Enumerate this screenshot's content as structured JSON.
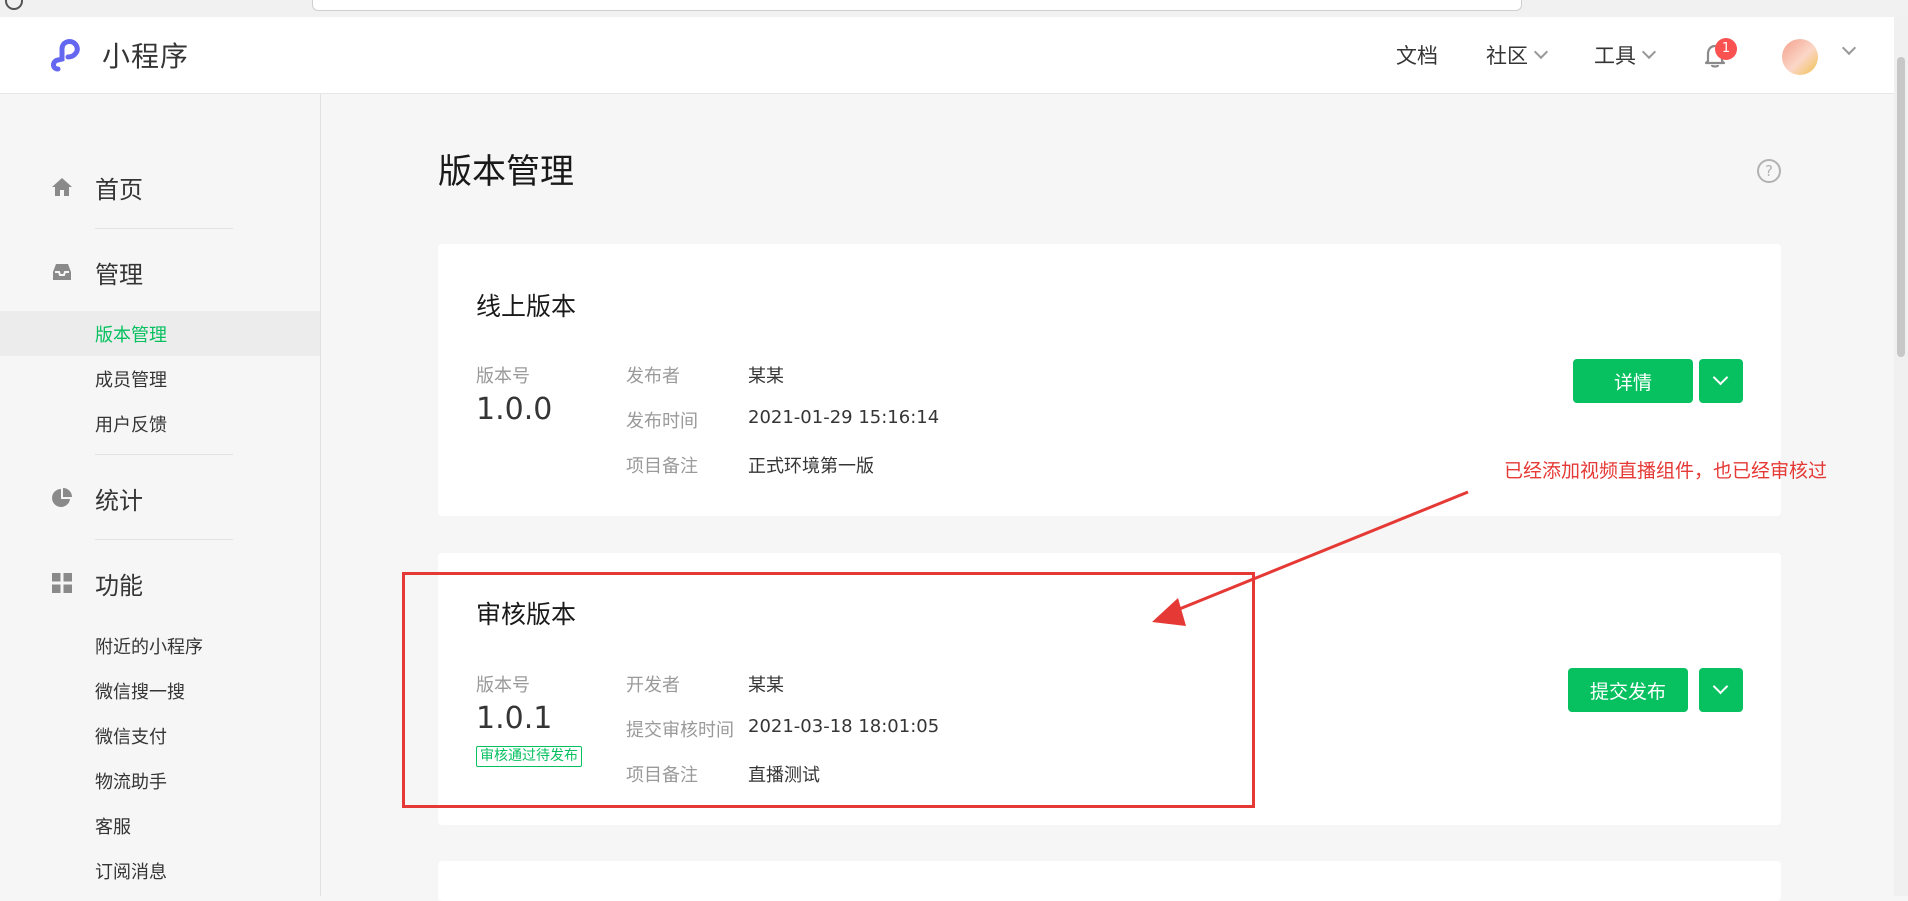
{
  "header": {
    "app_title": "小程序",
    "nav": {
      "docs": "文档",
      "community": "社区",
      "tools": "工具"
    },
    "notification_count": "1"
  },
  "sidebar": {
    "groups": [
      {
        "label": "首页",
        "icon": "home-icon"
      },
      {
        "label": "管理",
        "icon": "inbox-icon"
      },
      {
        "label": "统计",
        "icon": "pie-chart-icon"
      },
      {
        "label": "功能",
        "icon": "grid-icon"
      }
    ],
    "manage_items": [
      "版本管理",
      "成员管理",
      "用户反馈"
    ],
    "feature_items": [
      "附近的小程序",
      "微信搜一搜",
      "微信支付",
      "物流助手",
      "客服",
      "订阅消息"
    ],
    "active_item": "版本管理"
  },
  "main": {
    "title": "版本管理",
    "help": "?",
    "online": {
      "title": "线上版本",
      "version_label": "版本号",
      "version": "1.0.0",
      "publisher_label": "发布者",
      "publisher": "某某",
      "time_label": "发布时间",
      "time": "2021-01-29 15:16:14",
      "note_label": "项目备注",
      "note": "正式环境第一版",
      "button": "详情"
    },
    "review": {
      "title": "审核版本",
      "version_label": "版本号",
      "version": "1.0.1",
      "status": "审核通过待发布",
      "developer_label": "开发者",
      "developer": "某某",
      "time_label": "提交审核时间",
      "time": "2021-03-18 18:01:05",
      "note_label": "项目备注",
      "note": "直播测试",
      "button": "提交发布"
    }
  },
  "annotation": {
    "text": "已经添加视频直播组件，也已经审核过"
  },
  "colors": {
    "brand_green": "#07c160",
    "annotation_red": "#e53935",
    "badge_red": "#fa5151",
    "logo_purple": "#6467f0"
  }
}
